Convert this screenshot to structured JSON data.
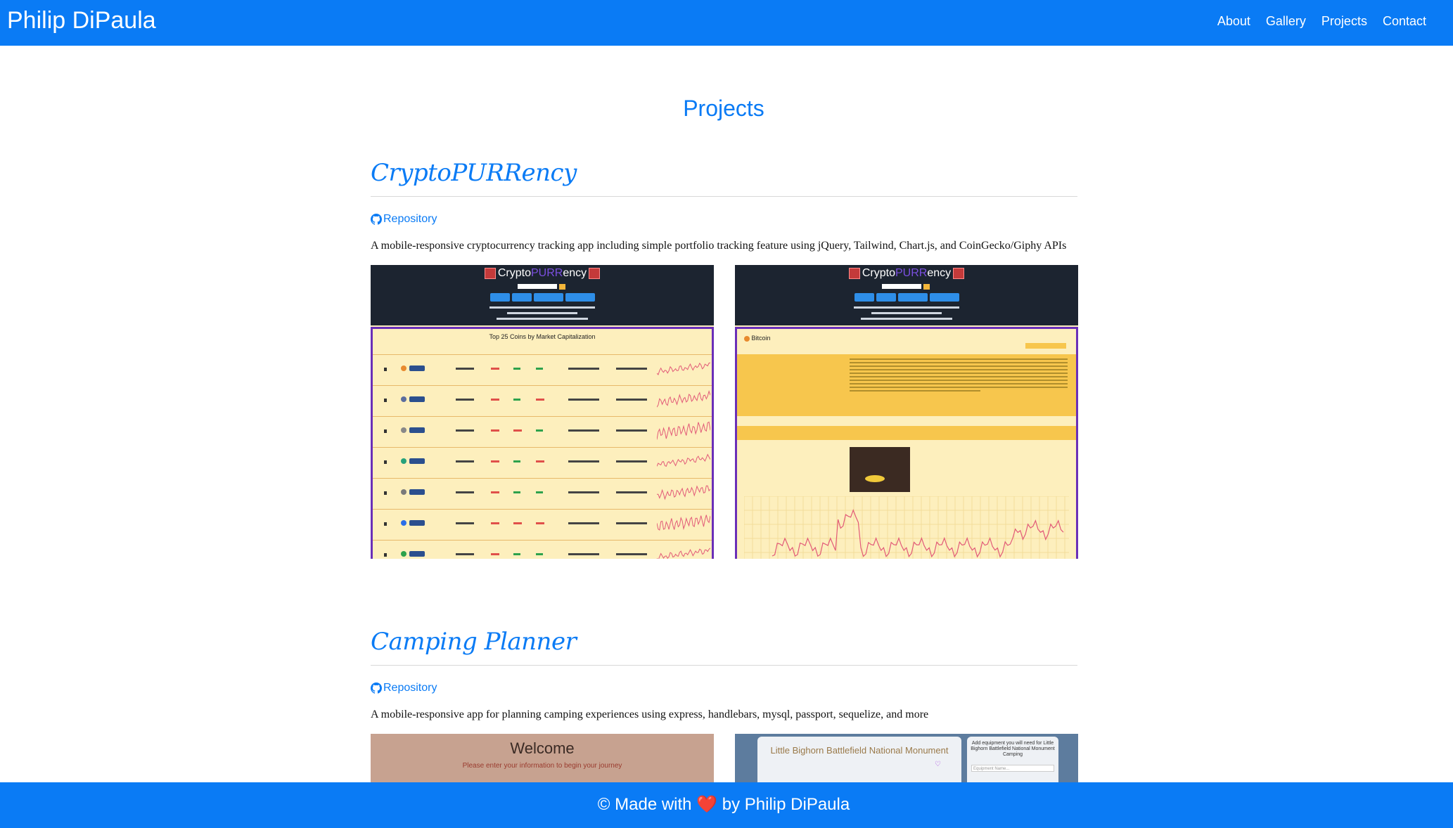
{
  "nav": {
    "brand": "Philip DiPaula",
    "links": [
      "About",
      "Gallery",
      "Projects",
      "Contact"
    ]
  },
  "page_title": "Projects",
  "projects": [
    {
      "title": "CryptoPURRency",
      "repo_label": "Repository",
      "description": "A mobile-responsive cryptocurrency tracking app including simple portfolio tracking feature using jQuery, Tailwind, Chart.js, and CoinGecko/Giphy APIs",
      "screenshots": [
        {
          "app_title_left": "Crypto",
          "app_title_mid": "PURR",
          "app_title_right": "ency",
          "panel_title": "Top 25 Coins by Market Capitalization"
        },
        {
          "app_title_left": "Crypto",
          "app_title_mid": "PURR",
          "app_title_right": "ency",
          "panel_title": "Bitcoin"
        }
      ]
    },
    {
      "title": "Camping Planner",
      "repo_label": "Repository",
      "description": "A mobile-responsive app for planning camping experiences using express, handlebars, mysql, passport, sequelize, and more",
      "screenshots": [
        {
          "heading": "Welcome",
          "subtext": "Please enter your information to begin your journey"
        },
        {
          "heading": "Little Bighorn Battlefield National Monument",
          "side_heading": "Add equipment you will need for Little Bighorn Battlefield National Monument Camping",
          "input_placeholder": "Equipment Name..."
        }
      ]
    }
  ],
  "footer": {
    "text_before": "© Made with",
    "heart": "❤️",
    "text_after": "by Philip DiPaula"
  },
  "colors": {
    "primary": "#0a7bf5",
    "app_dark": "#1c2430",
    "panel_border": "#6a2fb8",
    "panel_bg": "#fdefbd"
  }
}
